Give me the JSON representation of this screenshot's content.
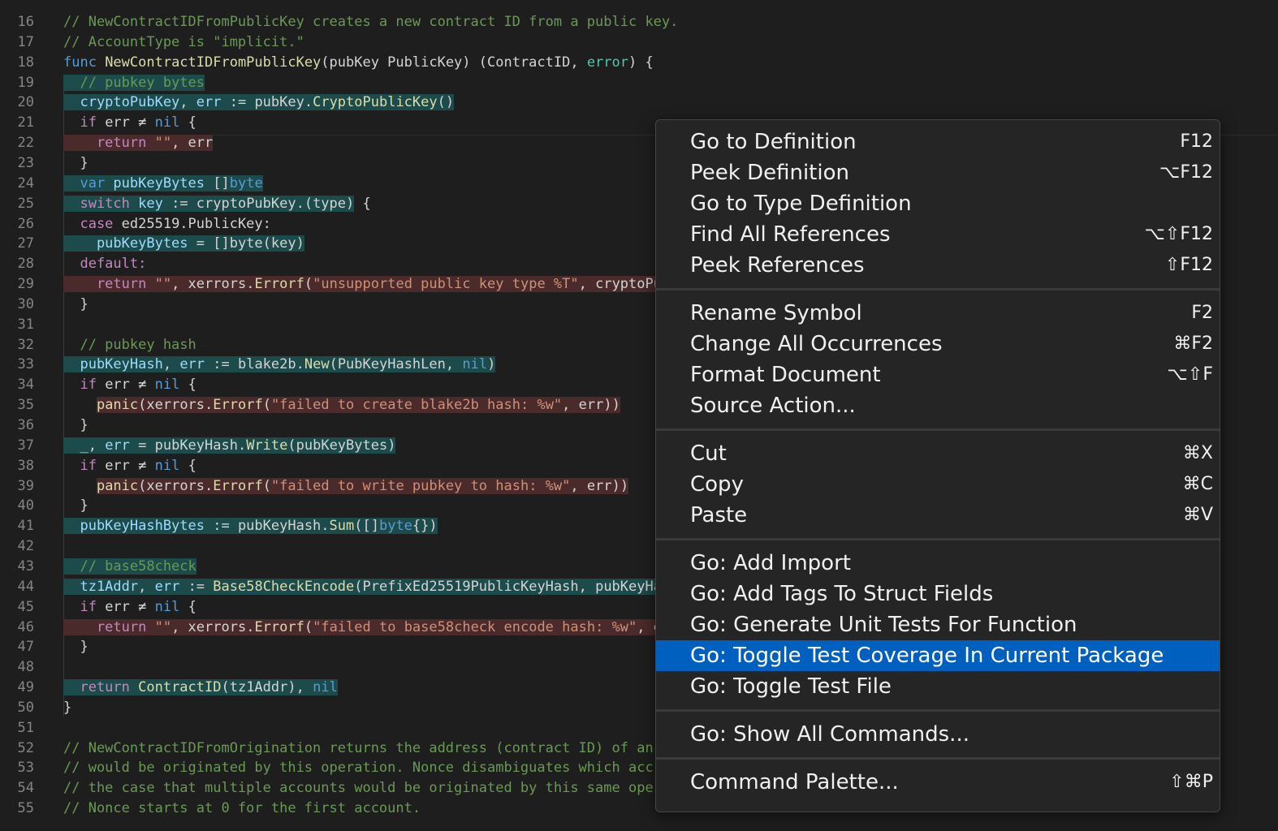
{
  "editor": {
    "lines": [
      {
        "n": "16",
        "segments": [
          {
            "t": "// NewContractIDFromPublicKey creates a new contract ID from a public key.",
            "c": "cm"
          }
        ]
      },
      {
        "n": "17",
        "segments": [
          {
            "t": "// AccountType is \"implicit.\"",
            "c": "cm"
          }
        ]
      },
      {
        "n": "18",
        "segments": [
          {
            "t": "func ",
            "c": "kw"
          },
          {
            "t": "NewContractIDFromPublicKey",
            "c": "fn"
          },
          {
            "t": "(pubKey PublicKey) (ContractID, ",
            "c": ""
          },
          {
            "t": "error",
            "c": "ty"
          },
          {
            "t": ") {",
            "c": ""
          }
        ]
      },
      {
        "n": "19",
        "segments": [
          {
            "t": "  // pubkey bytes",
            "c": "cm hl-g"
          }
        ]
      },
      {
        "n": "20",
        "segments": [
          {
            "t": "  cryptoPubKey",
            "c": "var hl-g"
          },
          {
            "t": ", ",
            "c": "hl-g"
          },
          {
            "t": "err",
            "c": "var hl-g"
          },
          {
            "t": " := pubKey.",
            "c": "hl-g"
          },
          {
            "t": "CryptoPublicKey",
            "c": "fn hl-g"
          },
          {
            "t": "()",
            "c": "hl-g"
          }
        ]
      },
      {
        "n": "21",
        "segments": [
          {
            "t": "  if ",
            "c": "kw2"
          },
          {
            "t": "err ≠ ",
            "c": ""
          },
          {
            "t": "nil",
            "c": "kw"
          },
          {
            "t": " {",
            "c": ""
          }
        ]
      },
      {
        "n": "22",
        "segments": [
          {
            "t": "    return ",
            "c": "kw2 hl-r"
          },
          {
            "t": "\"\"",
            "c": "str hl-r"
          },
          {
            "t": ", err",
            "c": "hl-r"
          }
        ]
      },
      {
        "n": "23",
        "segments": [
          {
            "t": "  }",
            "c": ""
          }
        ]
      },
      {
        "n": "24",
        "segments": [
          {
            "t": "  var ",
            "c": "kw hl-g"
          },
          {
            "t": "pubKeyBytes",
            "c": "var hl-g"
          },
          {
            "t": " []",
            "c": "hl-g"
          },
          {
            "t": "byte",
            "c": "kw hl-g"
          }
        ]
      },
      {
        "n": "25",
        "segments": [
          {
            "t": "  switch ",
            "c": "kw2 hl-g"
          },
          {
            "t": "key",
            "c": "var hl-g"
          },
          {
            "t": " := cryptoPubKey.(type)",
            "c": "hl-g"
          },
          {
            "t": " {",
            "c": ""
          }
        ]
      },
      {
        "n": "26",
        "segments": [
          {
            "t": "  case ",
            "c": "kw2"
          },
          {
            "t": "ed25519.PublicKey:",
            "c": ""
          }
        ]
      },
      {
        "n": "27",
        "segments": [
          {
            "t": "    pubKeyBytes",
            "c": "var hl-g"
          },
          {
            "t": " = []byte(key)",
            "c": "hl-g"
          }
        ]
      },
      {
        "n": "28",
        "segments": [
          {
            "t": "  default:",
            "c": "kw2"
          }
        ]
      },
      {
        "n": "29",
        "segments": [
          {
            "t": "    return ",
            "c": "kw2 hl-r"
          },
          {
            "t": "\"\"",
            "c": "str hl-r"
          },
          {
            "t": ", xerrors.",
            "c": "hl-r"
          },
          {
            "t": "Errorf",
            "c": "fn hl-r"
          },
          {
            "t": "(",
            "c": "hl-r"
          },
          {
            "t": "\"unsupported public key type %T\"",
            "c": "str hl-r"
          },
          {
            "t": ", cryptoPu",
            "c": "hl-r"
          }
        ]
      },
      {
        "n": "30",
        "segments": [
          {
            "t": "  }",
            "c": ""
          }
        ]
      },
      {
        "n": "31",
        "segments": []
      },
      {
        "n": "32",
        "segments": [
          {
            "t": "  // pubkey hash",
            "c": "cm"
          }
        ]
      },
      {
        "n": "33",
        "segments": [
          {
            "t": "  pubKeyHash",
            "c": "var hl-g"
          },
          {
            "t": ", ",
            "c": "hl-g"
          },
          {
            "t": "err",
            "c": "var hl-g"
          },
          {
            "t": " := blake2b.",
            "c": "hl-g"
          },
          {
            "t": "New",
            "c": "fn hl-g"
          },
          {
            "t": "(PubKeyHashLen, ",
            "c": "hl-g"
          },
          {
            "t": "nil",
            "c": "kw hl-g"
          },
          {
            "t": ")",
            "c": "hl-g"
          }
        ]
      },
      {
        "n": "34",
        "segments": [
          {
            "t": "  if ",
            "c": "kw2"
          },
          {
            "t": "err ≠ ",
            "c": ""
          },
          {
            "t": "nil",
            "c": "kw"
          },
          {
            "t": " {",
            "c": ""
          }
        ]
      },
      {
        "n": "35",
        "segments": [
          {
            "t": "    ",
            "c": ""
          },
          {
            "t": "panic",
            "c": "fn hl-r"
          },
          {
            "t": "(xerrors.",
            "c": "hl-r"
          },
          {
            "t": "Errorf",
            "c": "fn hl-r"
          },
          {
            "t": "(",
            "c": "hl-r"
          },
          {
            "t": "\"failed to create blake2b hash: %w\"",
            "c": "str hl-r"
          },
          {
            "t": ", err))",
            "c": "hl-r"
          }
        ]
      },
      {
        "n": "36",
        "segments": [
          {
            "t": "  }",
            "c": ""
          }
        ]
      },
      {
        "n": "37",
        "segments": [
          {
            "t": "  _, ",
            "c": "hl-g"
          },
          {
            "t": "err",
            "c": "var hl-g"
          },
          {
            "t": " = pubKeyHash.",
            "c": "hl-g"
          },
          {
            "t": "Write",
            "c": "fn hl-g"
          },
          {
            "t": "(pubKeyBytes)",
            "c": "hl-g"
          }
        ]
      },
      {
        "n": "38",
        "segments": [
          {
            "t": "  if ",
            "c": "kw2"
          },
          {
            "t": "err ≠ ",
            "c": ""
          },
          {
            "t": "nil",
            "c": "kw"
          },
          {
            "t": " {",
            "c": ""
          }
        ]
      },
      {
        "n": "39",
        "segments": [
          {
            "t": "    ",
            "c": ""
          },
          {
            "t": "panic",
            "c": "fn hl-r"
          },
          {
            "t": "(xerrors.",
            "c": "hl-r"
          },
          {
            "t": "Errorf",
            "c": "fn hl-r"
          },
          {
            "t": "(",
            "c": "hl-r"
          },
          {
            "t": "\"failed to write pubkey to hash: %w\"",
            "c": "str hl-r"
          },
          {
            "t": ", err))",
            "c": "hl-r"
          }
        ]
      },
      {
        "n": "40",
        "segments": [
          {
            "t": "  }",
            "c": ""
          }
        ]
      },
      {
        "n": "41",
        "segments": [
          {
            "t": "  pubKeyHashBytes",
            "c": "var hl-g"
          },
          {
            "t": " := pubKeyHash.",
            "c": "hl-g"
          },
          {
            "t": "Sum",
            "c": "fn hl-g"
          },
          {
            "t": "([]",
            "c": "hl-g"
          },
          {
            "t": "byte",
            "c": "kw hl-g"
          },
          {
            "t": "{})",
            "c": "hl-g"
          }
        ]
      },
      {
        "n": "42",
        "segments": []
      },
      {
        "n": "43",
        "segments": [
          {
            "t": "  // base58check",
            "c": "cm hl-g"
          }
        ]
      },
      {
        "n": "44",
        "segments": [
          {
            "t": "  tz1Addr",
            "c": "var hl-g"
          },
          {
            "t": ", ",
            "c": "hl-g"
          },
          {
            "t": "err",
            "c": "var hl-g"
          },
          {
            "t": " := ",
            "c": "hl-g"
          },
          {
            "t": "Base58CheckEncode",
            "c": "fn hl-g"
          },
          {
            "t": "(PrefixEd25519PublicKeyHash, pubKeyHa",
            "c": "hl-g"
          }
        ]
      },
      {
        "n": "45",
        "segments": [
          {
            "t": "  if ",
            "c": "kw2"
          },
          {
            "t": "err ≠ ",
            "c": ""
          },
          {
            "t": "nil",
            "c": "kw"
          },
          {
            "t": " {",
            "c": ""
          }
        ]
      },
      {
        "n": "46",
        "segments": [
          {
            "t": "    return ",
            "c": "kw2 hl-r"
          },
          {
            "t": "\"\"",
            "c": "str hl-r"
          },
          {
            "t": ", xerrors.",
            "c": "hl-r"
          },
          {
            "t": "Errorf",
            "c": "fn hl-r"
          },
          {
            "t": "(",
            "c": "hl-r"
          },
          {
            "t": "\"failed to base58check encode hash: %w\"",
            "c": "str hl-r"
          },
          {
            "t": ", e",
            "c": "hl-r"
          }
        ]
      },
      {
        "n": "47",
        "segments": [
          {
            "t": "  }",
            "c": ""
          }
        ]
      },
      {
        "n": "48",
        "segments": []
      },
      {
        "n": "49",
        "segments": [
          {
            "t": "  return ",
            "c": "kw2 hl-g"
          },
          {
            "t": "ContractID",
            "c": "fn hl-g"
          },
          {
            "t": "(tz1Addr), ",
            "c": "hl-g"
          },
          {
            "t": "nil",
            "c": "kw hl-g"
          }
        ]
      },
      {
        "n": "50",
        "segments": [
          {
            "t": "}",
            "c": ""
          }
        ]
      },
      {
        "n": "51",
        "segments": []
      },
      {
        "n": "52",
        "segments": [
          {
            "t": "// NewContractIDFromOrigination returns the address (contract ID) of an",
            "c": "cm"
          }
        ]
      },
      {
        "n": "53",
        "segments": [
          {
            "t": "// would be originated by this operation. Nonce disambiguates which acc",
            "c": "cm"
          }
        ]
      },
      {
        "n": "54",
        "segments": [
          {
            "t": "// the case that multiple accounts would be originated by this same oper",
            "c": "cm"
          }
        ]
      },
      {
        "n": "55",
        "segments": [
          {
            "t": "// Nonce starts at 0 for the first account.",
            "c": "cm"
          }
        ]
      }
    ]
  },
  "menu": {
    "groups": [
      [
        {
          "label": "Go to Definition",
          "key": "F12"
        },
        {
          "label": "Peek Definition",
          "key": "⌥F12"
        },
        {
          "label": "Go to Type Definition",
          "key": ""
        },
        {
          "label": "Find All References",
          "key": "⌥⇧F12"
        },
        {
          "label": "Peek References",
          "key": "⇧F12"
        }
      ],
      [
        {
          "label": "Rename Symbol",
          "key": "F2"
        },
        {
          "label": "Change All Occurrences",
          "key": "⌘F2"
        },
        {
          "label": "Format Document",
          "key": "⌥⇧F"
        },
        {
          "label": "Source Action...",
          "key": ""
        }
      ],
      [
        {
          "label": "Cut",
          "key": "⌘X"
        },
        {
          "label": "Copy",
          "key": "⌘C"
        },
        {
          "label": "Paste",
          "key": "⌘V"
        }
      ],
      [
        {
          "label": "Go: Add Import",
          "key": ""
        },
        {
          "label": "Go: Add Tags To Struct Fields",
          "key": ""
        },
        {
          "label": "Go: Generate Unit Tests For Function",
          "key": ""
        },
        {
          "label": "Go: Toggle Test Coverage In Current Package",
          "key": "",
          "active": true
        },
        {
          "label": "Go: Toggle Test File",
          "key": ""
        }
      ],
      [
        {
          "label": "Go: Show All Commands...",
          "key": ""
        }
      ],
      [
        {
          "label": "Command Palette...",
          "key": "⇧⌘P"
        }
      ]
    ]
  }
}
